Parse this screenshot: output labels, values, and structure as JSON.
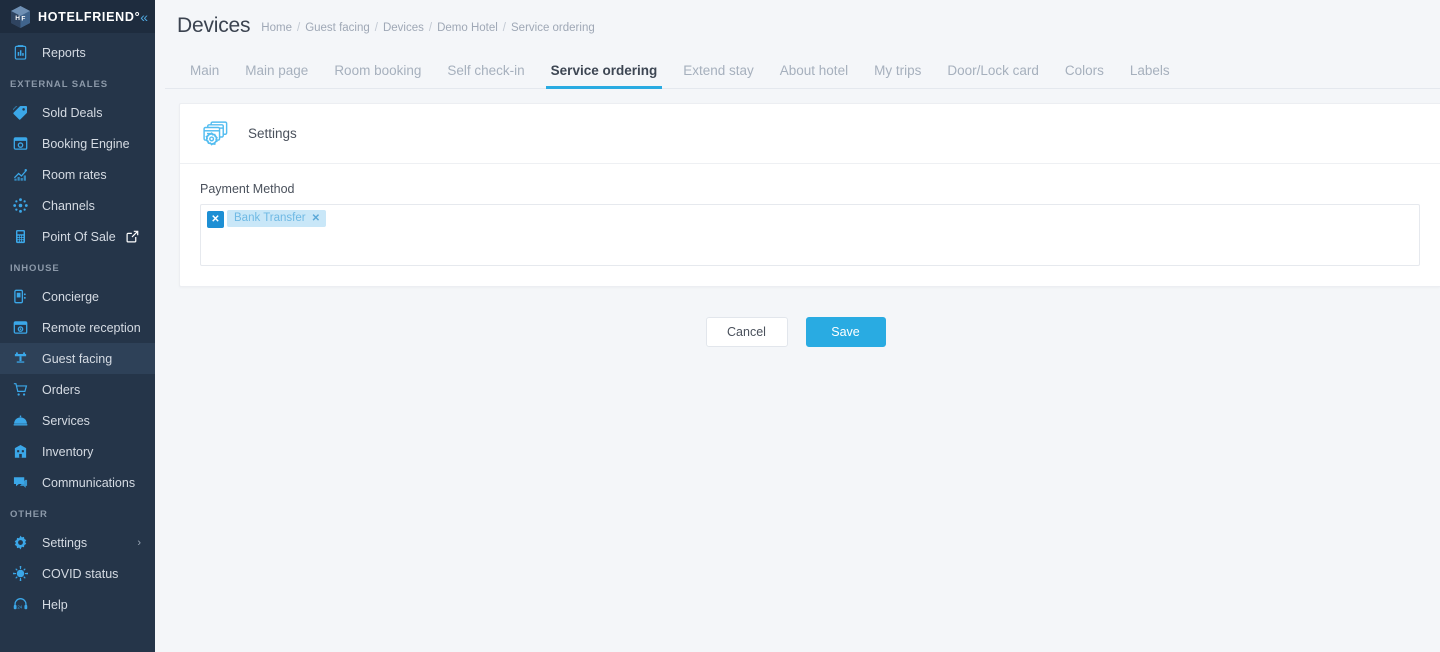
{
  "brand": {
    "name": "HOTELFRIEND°",
    "logo_icon": "cube-hf-logo-icon",
    "collapse_icon": "chevron-double-left-icon"
  },
  "sidebar": {
    "groups": [
      {
        "section": null,
        "items": [
          {
            "label": "Reports",
            "icon": "clipboard-report-icon",
            "active": false,
            "external": false,
            "chevron": false
          }
        ]
      },
      {
        "section": "EXTERNAL SALES",
        "items": [
          {
            "label": "Sold Deals",
            "icon": "tag-icon",
            "active": false,
            "external": false,
            "chevron": false
          },
          {
            "label": "Booking Engine",
            "icon": "browser-window-icon",
            "active": false,
            "external": false,
            "chevron": false
          },
          {
            "label": "Room rates",
            "icon": "chart-line-icon",
            "active": false,
            "external": false,
            "chevron": false
          },
          {
            "label": "Channels",
            "icon": "network-nodes-icon",
            "active": false,
            "external": false,
            "chevron": false
          },
          {
            "label": "Point Of Sale",
            "icon": "calculator-pos-icon",
            "active": false,
            "external": true,
            "chevron": false
          }
        ]
      },
      {
        "section": "INHOUSE",
        "items": [
          {
            "label": "Concierge",
            "icon": "mobile-concierge-icon",
            "active": false,
            "external": false,
            "chevron": false
          },
          {
            "label": "Remote reception",
            "icon": "reception-screen-icon",
            "active": false,
            "external": false,
            "chevron": false
          },
          {
            "label": "Guest facing",
            "icon": "guest-facing-icon",
            "active": true,
            "external": false,
            "chevron": false
          },
          {
            "label": "Orders",
            "icon": "shopping-cart-icon",
            "active": false,
            "external": false,
            "chevron": false
          },
          {
            "label": "Services",
            "icon": "room-service-bell-icon",
            "active": false,
            "external": false,
            "chevron": false
          },
          {
            "label": "Inventory",
            "icon": "inventory-box-icon",
            "active": false,
            "external": false,
            "chevron": false
          },
          {
            "label": "Communications",
            "icon": "chat-bubbles-icon",
            "active": false,
            "external": false,
            "chevron": false
          }
        ]
      },
      {
        "section": "OTHER",
        "items": [
          {
            "label": "Settings",
            "icon": "gear-icon",
            "active": false,
            "external": false,
            "chevron": true
          },
          {
            "label": "COVID status",
            "icon": "virus-icon",
            "active": false,
            "external": false,
            "chevron": false
          },
          {
            "label": "Help",
            "icon": "headset-support-icon",
            "active": false,
            "external": false,
            "chevron": false
          }
        ]
      }
    ],
    "external_icon": "external-link-icon",
    "chevron_icon": "chevron-right-icon"
  },
  "header": {
    "title": "Devices",
    "breadcrumb": [
      "Home",
      "Guest facing",
      "Devices",
      "Demo Hotel",
      "Service ordering"
    ],
    "breadcrumb_separator": "/"
  },
  "tabs": [
    {
      "label": "Main",
      "active": false
    },
    {
      "label": "Main page",
      "active": false
    },
    {
      "label": "Room booking",
      "active": false
    },
    {
      "label": "Self check-in",
      "active": false
    },
    {
      "label": "Service ordering",
      "active": true
    },
    {
      "label": "Extend stay",
      "active": false
    },
    {
      "label": "About hotel",
      "active": false
    },
    {
      "label": "My trips",
      "active": false
    },
    {
      "label": "Door/Lock card",
      "active": false
    },
    {
      "label": "Colors",
      "active": false
    },
    {
      "label": "Labels",
      "active": false
    }
  ],
  "card": {
    "icon": "settings-windows-gear-icon",
    "title": "Settings",
    "payment_method": {
      "label": "Payment Method",
      "clear_all_label": "✕",
      "clear_all_icon": "clear-all-icon",
      "chips": [
        {
          "label": "Bank Transfer",
          "remove_label": "✕"
        }
      ]
    }
  },
  "footer_actions": {
    "cancel_label": "Cancel",
    "save_label": "Save"
  },
  "colors": {
    "accent": "#29abe2",
    "sidebar_bg": "#253549",
    "sidebar_active": "#2e4158",
    "icon_blue": "#3ba7e8",
    "chip_bg": "#c9e7f8",
    "chip_text": "#6fb9e4",
    "page_bg": "#f4f6f9"
  }
}
